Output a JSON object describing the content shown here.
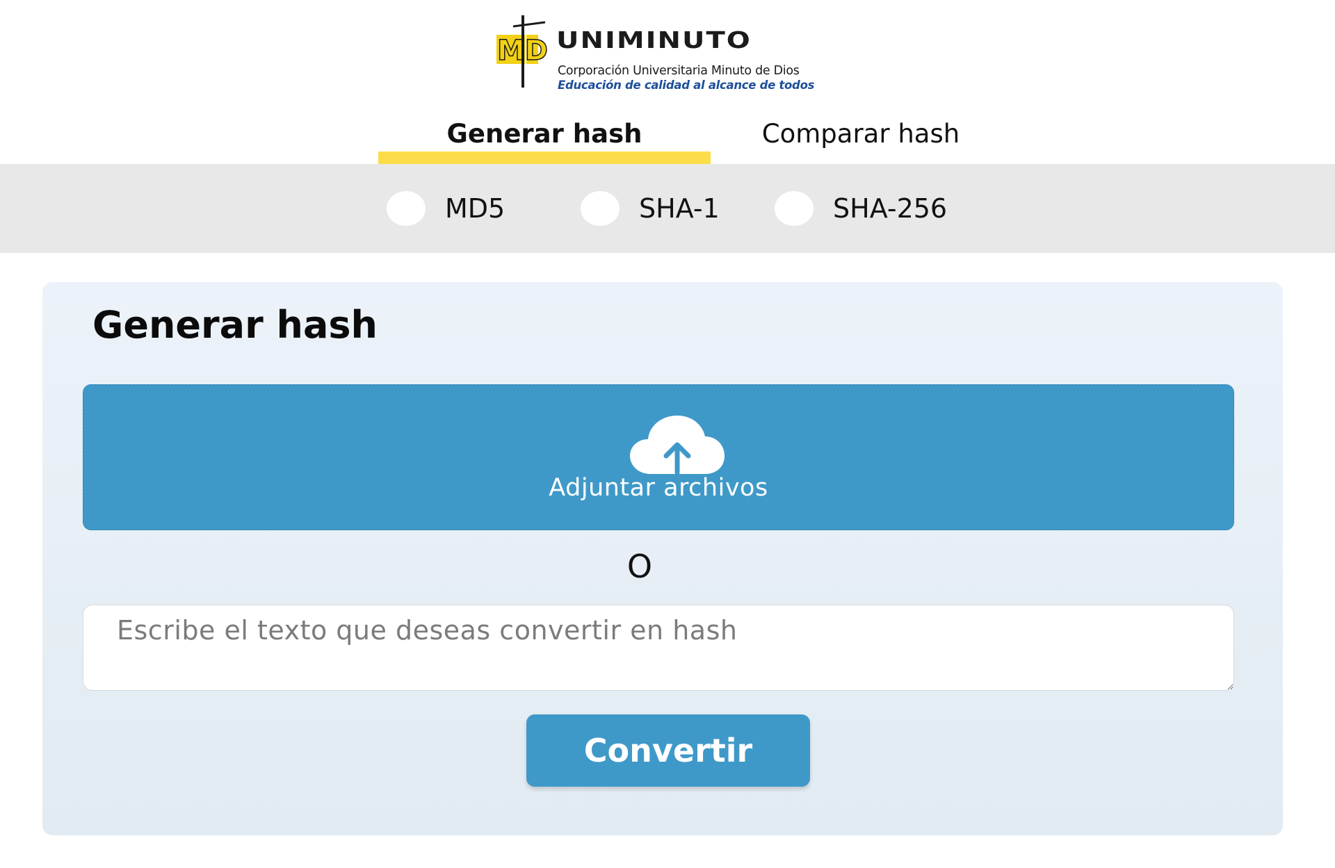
{
  "logo": {
    "name": "UNIMINUTO",
    "subtitle": "Corporación Universitaria Minuto de Dios",
    "tagline": "Educación de calidad al alcance de todos",
    "mark_text": "MD",
    "brand_yellow": "#fbdd4b",
    "brand_blue": "#1f4f9a"
  },
  "tabs": [
    {
      "label": "Generar hash",
      "active": true
    },
    {
      "label": "Comparar hash",
      "active": false
    }
  ],
  "algorithms": [
    {
      "label": "MD5",
      "selected": false
    },
    {
      "label": "SHA-1",
      "selected": false
    },
    {
      "label": "SHA-256",
      "selected": false
    }
  ],
  "card": {
    "title": "Generar hash",
    "upload_label": "Adjuntar archivos",
    "or_text": "O",
    "text_placeholder": "Escribe el texto que deseas convertir en hash",
    "text_value": "",
    "convert_label": "Convertir"
  },
  "icons": {
    "upload": "cloud-upload-icon",
    "logo": "uniminuto-logo-icon"
  },
  "colors": {
    "accent": "#3f99c8",
    "tab_indicator": "#fbdd4b",
    "algo_bar_bg": "#e8e8e8"
  }
}
